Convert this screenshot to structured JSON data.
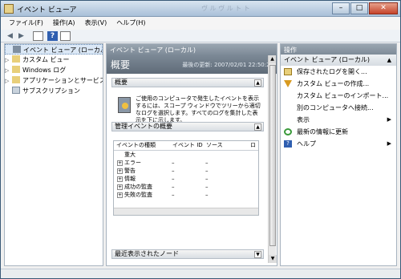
{
  "window": {
    "title": "イベント ビューア",
    "ghost_text": "ヴ ル ヴ ル ト ト",
    "minimize": "–",
    "maximize": "□",
    "close": "✕"
  },
  "menu": [
    "ファイル(F)",
    "操作(A)",
    "表示(V)",
    "ヘルプ(H)"
  ],
  "toolbar": {
    "back": "◀",
    "forward": "▶",
    "help": "?"
  },
  "tree": {
    "items": [
      {
        "label": "イベント ビューア (ローカル)",
        "expander": ""
      },
      {
        "label": "カスタム ビュー",
        "expander": "▷"
      },
      {
        "label": "Windows ログ",
        "expander": "▷"
      },
      {
        "label": "アプリケーションとサービス",
        "expander": "▷"
      },
      {
        "label": "サブスクリプション",
        "expander": ""
      }
    ]
  },
  "center": {
    "header": "イベント ビューア (ローカル)",
    "title": "概要",
    "updated": "最後の更新: 2007/02/01 22:50:21",
    "overview_header": "概要",
    "overview_text": "ご使用のコンピュータで発生したイベントを表示するには、スコープ ウィンドウでツリーから適切なログを選択します。すべてのログを集計した表示を下に示します。",
    "admin_header": "管理イベントの概要",
    "columns": [
      "イベントの種類",
      "イベント ID",
      "ソース",
      "ロ"
    ],
    "rows": [
      {
        "type": "重大",
        "id": "",
        "source": "",
        "expand": false
      },
      {
        "type": "エラー",
        "id": "–",
        "source": "–",
        "expand": true
      },
      {
        "type": "警告",
        "id": "–",
        "source": "–",
        "expand": true
      },
      {
        "type": "情報",
        "id": "–",
        "source": "–",
        "expand": true
      },
      {
        "type": "成功の監査",
        "id": "–",
        "source": "–",
        "expand": true
      },
      {
        "type": "失敗の監査",
        "id": "–",
        "source": "–",
        "expand": true
      }
    ],
    "recent_header": "最近表示されたノード"
  },
  "actions": {
    "header": "操作",
    "section": "イベント ビューア (ローカル)",
    "items": [
      {
        "label": "保存されたログを開く...",
        "icon": "open-folder-icon",
        "submenu": false
      },
      {
        "label": "カスタム ビューの作成...",
        "icon": "filter-icon",
        "submenu": false
      },
      {
        "label": "カスタム ビューのインポート...",
        "icon": "",
        "submenu": false
      },
      {
        "label": "別のコンピュータへ接続...",
        "icon": "",
        "submenu": false
      },
      {
        "label": "表示",
        "icon": "",
        "submenu": true
      },
      {
        "label": "最新の情報に更新",
        "icon": "refresh-icon",
        "submenu": false
      },
      {
        "label": "ヘルプ",
        "icon": "help-icon",
        "submenu": true
      }
    ]
  },
  "colors": {
    "accent": "#7e8b98",
    "selection": "#dbe8f6"
  }
}
